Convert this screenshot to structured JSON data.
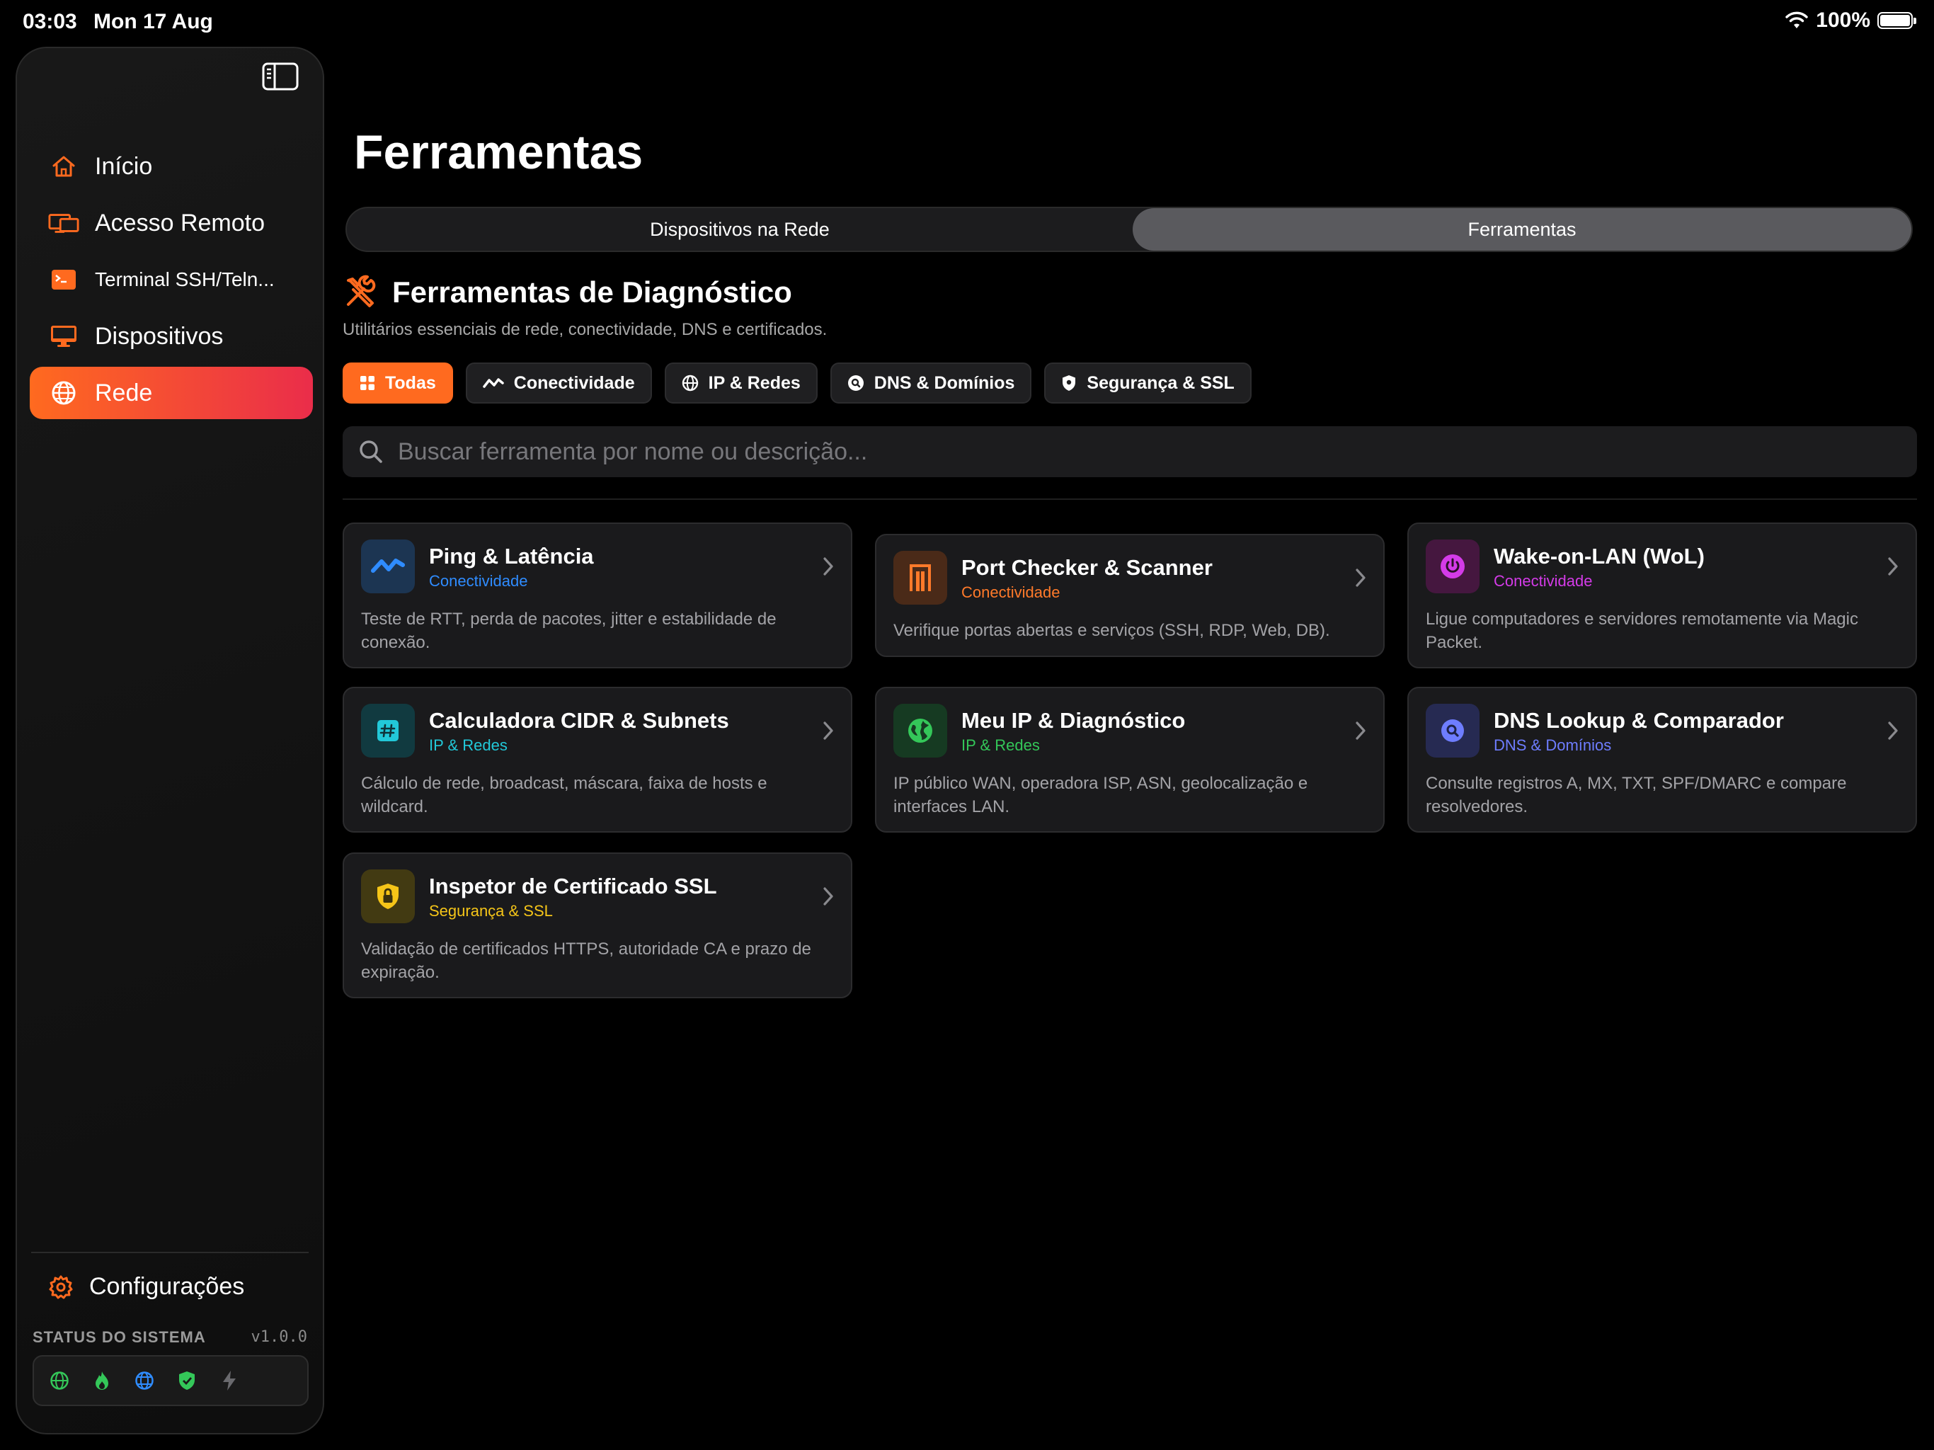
{
  "status_bar": {
    "time": "03:03",
    "date": "Mon 17 Aug",
    "battery": "100%"
  },
  "sidebar": {
    "items": [
      {
        "label": "Início",
        "icon": "home-icon",
        "color": "#ff6a1f",
        "active": false
      },
      {
        "label": "Acesso Remoto",
        "icon": "remote-desktop-icon",
        "color": "#ff6a1f",
        "active": false
      },
      {
        "label": "Terminal SSH/Teln...",
        "icon": "terminal-icon",
        "color": "#ff6a1f",
        "active": false
      },
      {
        "label": "Dispositivos",
        "icon": "monitor-icon",
        "color": "#ff6a1f",
        "active": false
      },
      {
        "label": "Rede",
        "icon": "network-globe-icon",
        "color": "#ffffff",
        "active": true
      }
    ],
    "settings_label": "Configurações",
    "system_status_label": "STATUS DO SISTEMA",
    "version": "v1.0.0",
    "status_icons": [
      "globe-status-icon",
      "flame-status-icon",
      "network-status-icon",
      "shield-status-icon",
      "bolt-status-icon"
    ]
  },
  "main": {
    "title": "Ferramentas",
    "segments": [
      {
        "label": "Dispositivos na Rede",
        "selected": false
      },
      {
        "label": "Ferramentas",
        "selected": true
      }
    ],
    "section_title": "Ferramentas de Diagnóstico",
    "section_subtitle": "Utilitários essenciais de rede, conectividade, DNS e certificados.",
    "filters": [
      {
        "label": "Todas",
        "icon": "grid-icon",
        "active": true
      },
      {
        "label": "Conectividade",
        "icon": "waveform-icon",
        "active": false
      },
      {
        "label": "IP & Redes",
        "icon": "globe-icon",
        "active": false
      },
      {
        "label": "DNS & Domínios",
        "icon": "dns-search-icon",
        "active": false
      },
      {
        "label": "Segurança & SSL",
        "icon": "shield-icon",
        "active": false
      }
    ],
    "search_placeholder": "Buscar ferramenta por nome ou descrição...",
    "tools": [
      {
        "title": "Ping & Latência",
        "category": "Conectividade",
        "description": "Teste de RTT, perda de pacotes, jitter e estabilidade de conexão.",
        "icon": "ping-wave-icon",
        "accent": "#2f8cff"
      },
      {
        "title": "Port Checker & Scanner",
        "category": "Conectividade",
        "description": "Verifique portas abertas e serviços (SSH, RDP, Web, DB).",
        "icon": "port-icon",
        "accent": "#ff7a2a"
      },
      {
        "title": "Wake-on-LAN (WoL)",
        "category": "Conectividade",
        "description": "Ligue computadores e servidores remotamente via Magic Packet.",
        "icon": "power-icon",
        "accent": "#d43be8"
      },
      {
        "title": "Calculadora CIDR & Subnets",
        "category": "IP & Redes",
        "description": "Cálculo de rede, broadcast, máscara, faixa de hosts e wildcard.",
        "icon": "hash-icon",
        "accent": "#22c8d8"
      },
      {
        "title": "Meu IP & Diagnóstico",
        "category": "IP & Redes",
        "description": "IP público WAN, operadora ISP, ASN, geolocalização e interfaces LAN.",
        "icon": "earth-icon",
        "accent": "#34c759"
      },
      {
        "title": "DNS Lookup & Comparador",
        "category": "DNS & Domínios",
        "description": "Consulte registros A, MX, TXT, SPF/DMARC e compare resolvedores.",
        "icon": "magnifier-icon",
        "accent": "#6e7dff"
      },
      {
        "title": "Inspetor de Certificado SSL",
        "category": "Segurança & SSL",
        "description": "Validação de certificados HTTPS, autoridade CA e prazo de expiração.",
        "icon": "lock-shield-icon",
        "accent": "#f5c518"
      }
    ]
  }
}
